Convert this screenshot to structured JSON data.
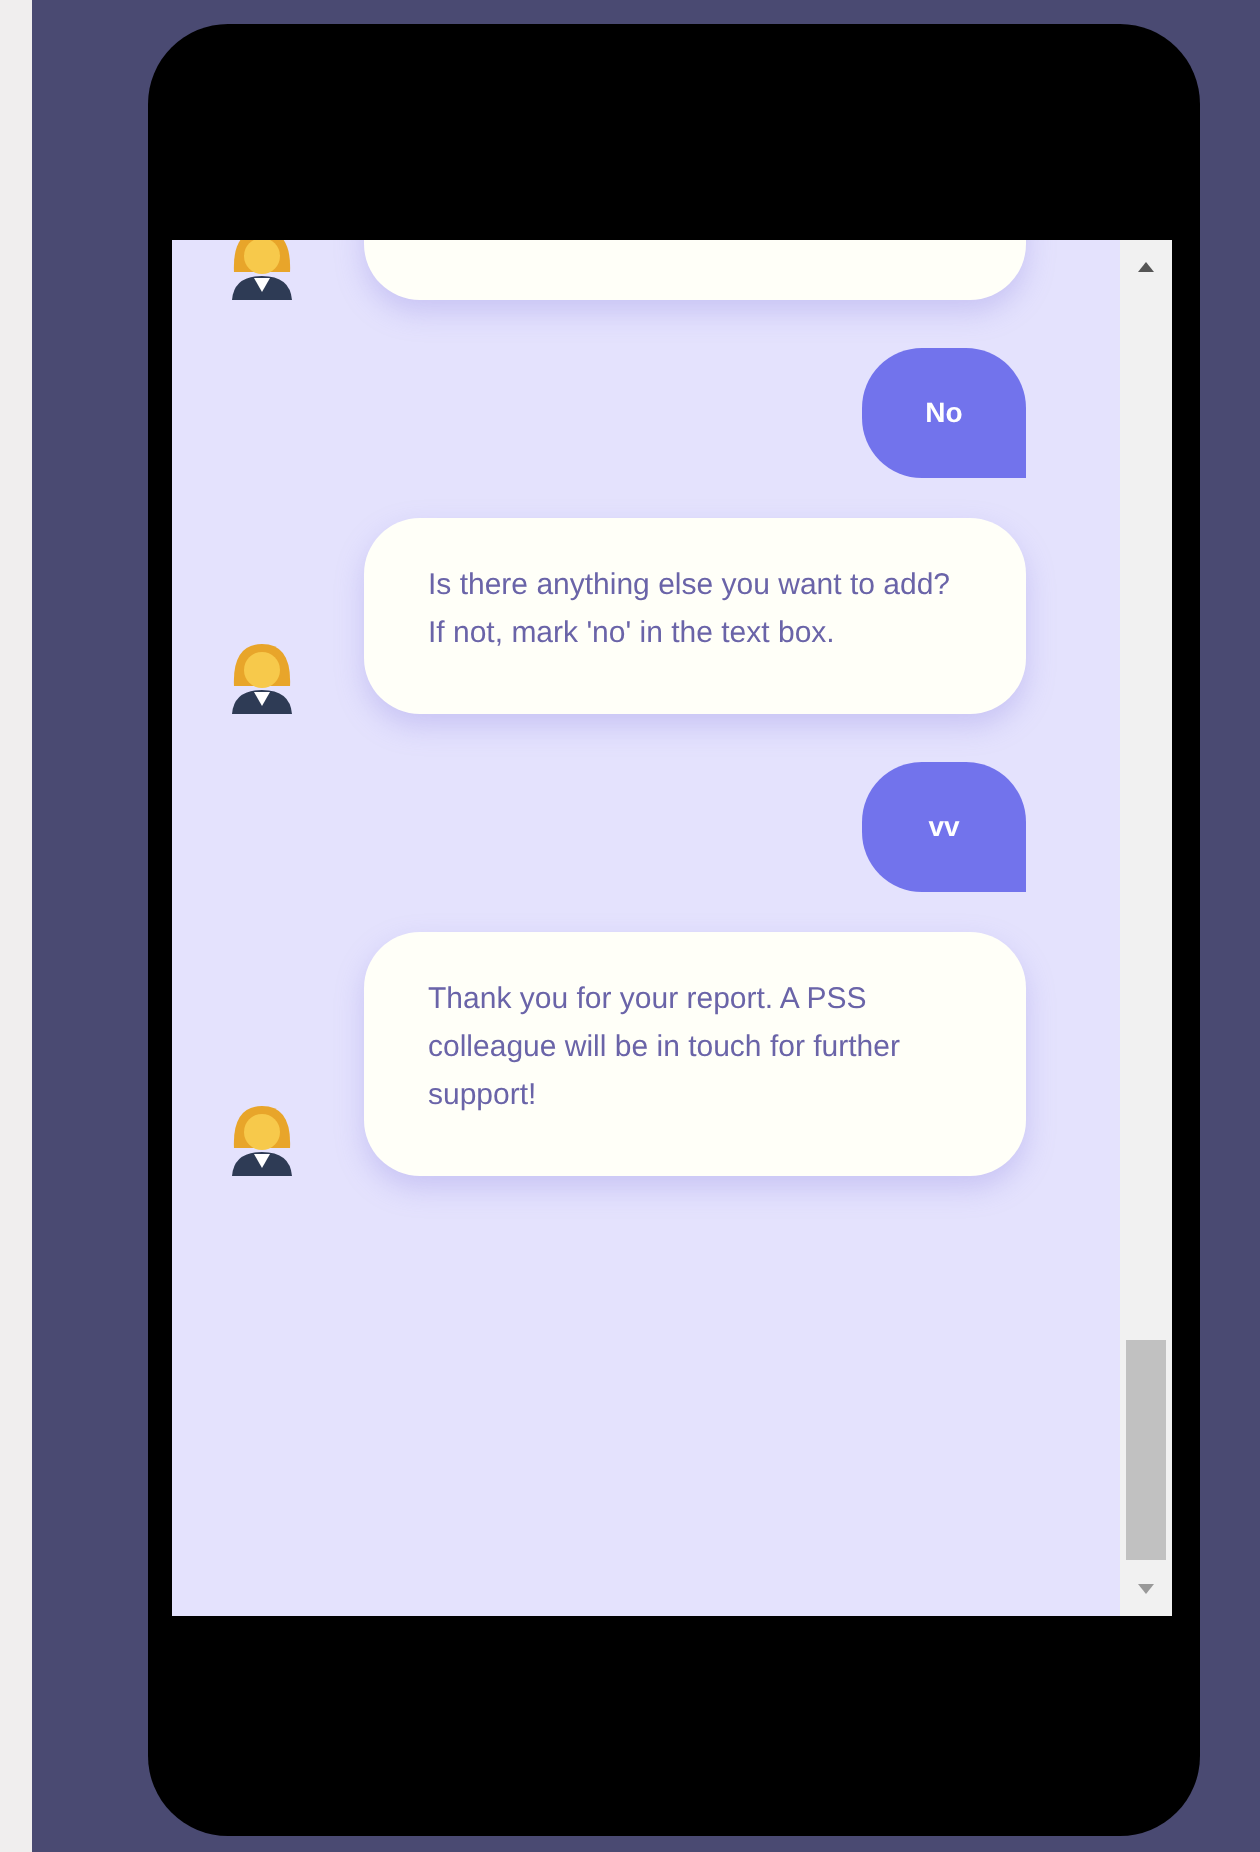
{
  "messages": [
    {
      "kind": "bot"
    },
    {
      "kind": "user",
      "text": "No"
    },
    {
      "kind": "bot",
      "text": "Is there anything else you want to add? If not, mark 'no' in the text box."
    },
    {
      "kind": "user",
      "text": "vv"
    },
    {
      "kind": "bot",
      "text": "Thank you for your report. A PSS colleague will be in touch for further support!"
    }
  ]
}
